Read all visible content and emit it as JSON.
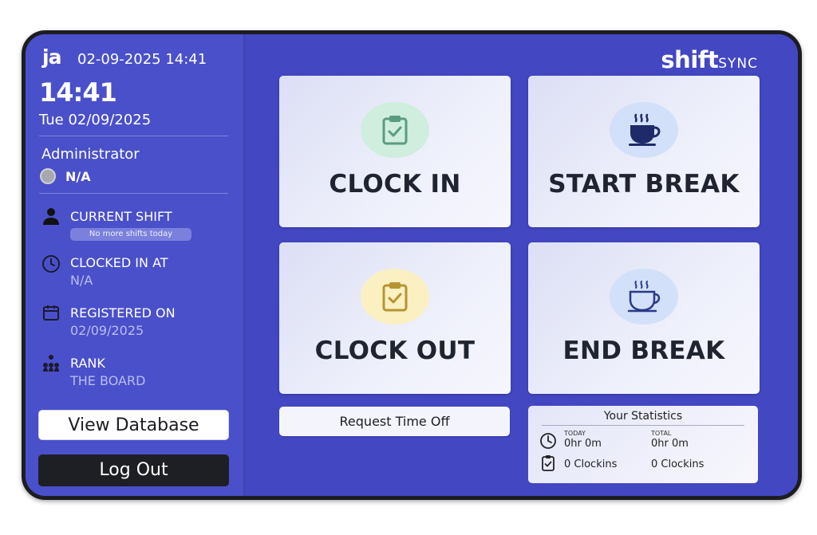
{
  "sidebar": {
    "logo": "ja",
    "top_datetime": "02-09-2025 14:41",
    "time": "14:41",
    "date": "Tue 02/09/2025",
    "role": "Administrator",
    "status": "N/A",
    "current_shift": {
      "label": "CURRENT SHIFT",
      "value": "No more shifts today"
    },
    "clocked_in": {
      "label": "CLOCKED IN AT",
      "value": "N/A"
    },
    "registered": {
      "label": "REGISTERED ON",
      "value": "02/09/2025"
    },
    "rank": {
      "label": "RANK",
      "value": "THE BOARD"
    },
    "view_database": "View Database",
    "logout": "Log Out"
  },
  "brand": {
    "part1": "shift",
    "part2": "SYNC"
  },
  "actions": {
    "clock_in": {
      "label": "CLOCK IN",
      "icon": "clipboard-check-icon",
      "color": "#cfeedd"
    },
    "start_break": {
      "label": "START BREAK",
      "icon": "coffee-cup-icon",
      "color": "#d3e0f9"
    },
    "clock_out": {
      "label": "CLOCK OUT",
      "icon": "clipboard-check-icon",
      "color": "#fbf0c2"
    },
    "end_break": {
      "label": "END BREAK",
      "icon": "coffee-cup-outline-icon",
      "color": "#d3e0f9"
    }
  },
  "request_time_off": "Request Time Off",
  "statistics": {
    "title": "Your Statistics",
    "today_label": "TODAY",
    "total_label": "TOTAL",
    "today_hours": "0hr 0m",
    "total_hours": "0hr 0m",
    "today_clockins": "0 Clockins",
    "total_clockins": "0 Clockins"
  },
  "colors": {
    "panel": "#4a50c9",
    "main": "#4347c2",
    "logout_bg": "#1e1f24"
  }
}
